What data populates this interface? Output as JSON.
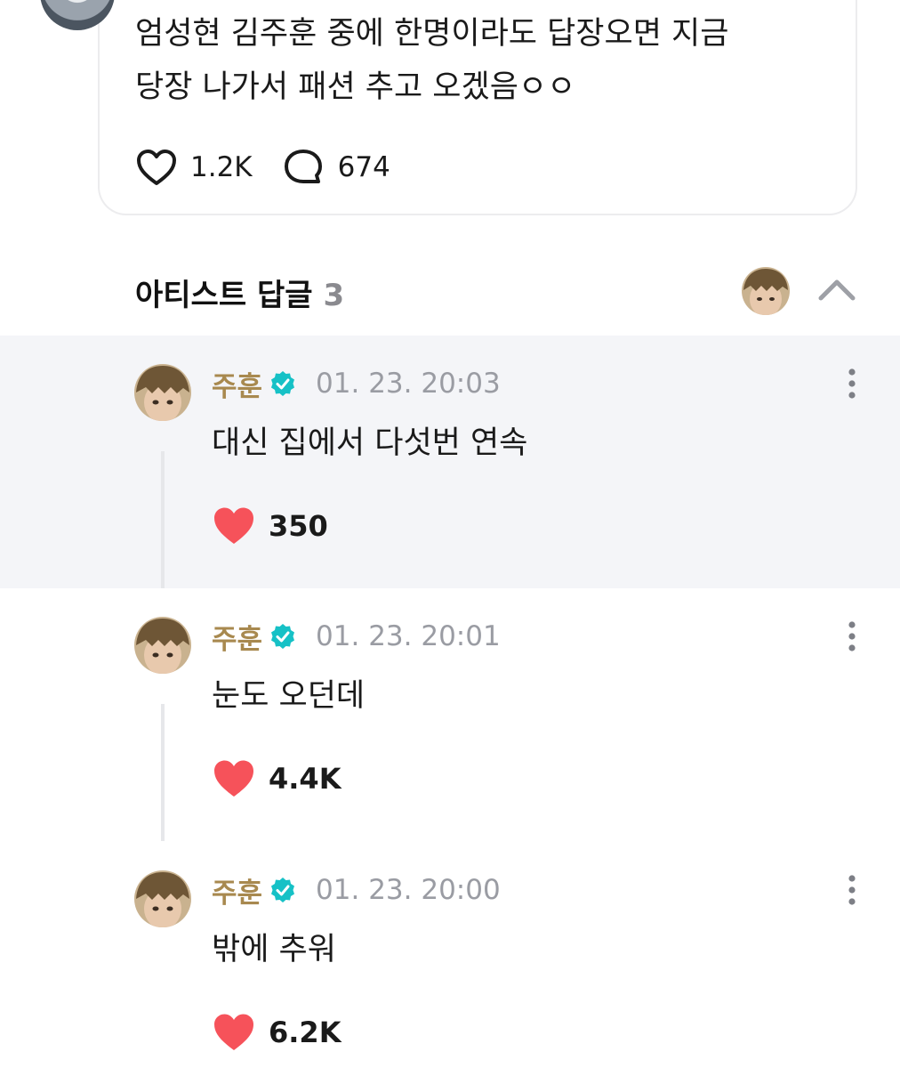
{
  "post": {
    "text": "엄성현 김주훈 중에 한명이라도 답장오면 지금\n당장 나가서 패션 추고 오겠음ㅇㅇ",
    "like_count": "1.2K",
    "comment_count": "674"
  },
  "replies_section": {
    "title": "아티스트 답글",
    "count": "3"
  },
  "replies": [
    {
      "author": "주훈",
      "time": "01. 23. 20:03",
      "text": "대신 집에서 다섯번 연속",
      "likes": "350"
    },
    {
      "author": "주훈",
      "time": "01. 23. 20:01",
      "text": "눈도 오던데",
      "likes": "4.4K"
    },
    {
      "author": "주훈",
      "time": "01. 23. 20:00",
      "text": "밖에 추워",
      "likes": "6.2K"
    }
  ],
  "colors": {
    "author": "#a8894f",
    "verified": "#16c1c6",
    "like_heart": "#f6525a",
    "highlight_bg": "#f4f5f8"
  },
  "icons": [
    "heart-outline-icon",
    "comment-bubble-icon",
    "chevron-up-icon",
    "verified-badge-icon",
    "more-vertical-icon",
    "heart-filled-icon"
  ]
}
